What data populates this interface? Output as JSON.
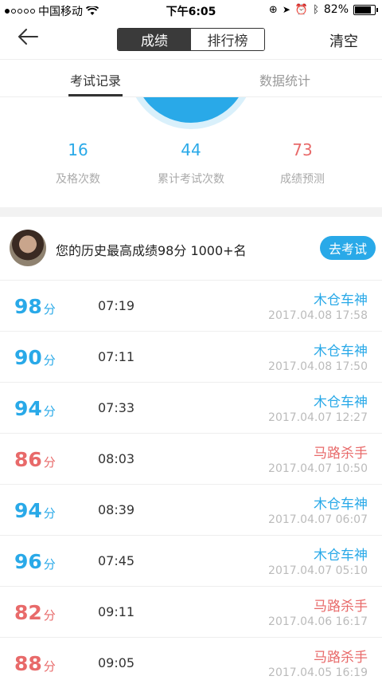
{
  "status_bar": {
    "carrier": "中国移动",
    "time": "下午6:05",
    "battery": "82%",
    "battery_level": 0.82
  },
  "nav": {
    "segments": [
      "成绩",
      "排行榜"
    ],
    "clear_label": "清空"
  },
  "tabs": [
    "考试记录",
    "数据统计"
  ],
  "stats": [
    {
      "value": "16",
      "label": "及格次数"
    },
    {
      "value": "44",
      "label": "累计考试次数"
    },
    {
      "value": "73",
      "label": "成绩预测"
    }
  ],
  "best": {
    "text": "您的历史最高成绩98分  1000+名",
    "button": "去考试"
  },
  "colors": {
    "accent_blue": "#29a9e8",
    "accent_red": "#e86a6a"
  },
  "records": [
    {
      "score": "98",
      "unit": "分",
      "duration": "07:19",
      "title": "木仓车神",
      "date": "2017.04.08 17:58",
      "tone": "blue"
    },
    {
      "score": "90",
      "unit": "分",
      "duration": "07:11",
      "title": "木仓车神",
      "date": "2017.04.08 17:50",
      "tone": "blue"
    },
    {
      "score": "94",
      "unit": "分",
      "duration": "07:33",
      "title": "木仓车神",
      "date": "2017.04.07 12:27",
      "tone": "blue"
    },
    {
      "score": "86",
      "unit": "分",
      "duration": "08:03",
      "title": "马路杀手",
      "date": "2017.04.07 10:50",
      "tone": "red"
    },
    {
      "score": "94",
      "unit": "分",
      "duration": "08:39",
      "title": "木仓车神",
      "date": "2017.04.07 06:07",
      "tone": "blue"
    },
    {
      "score": "96",
      "unit": "分",
      "duration": "07:45",
      "title": "木仓车神",
      "date": "2017.04.07 05:10",
      "tone": "blue"
    },
    {
      "score": "82",
      "unit": "分",
      "duration": "09:11",
      "title": "马路杀手",
      "date": "2017.04.06 16:17",
      "tone": "red"
    },
    {
      "score": "88",
      "unit": "分",
      "duration": "09:05",
      "title": "马路杀手",
      "date": "2017.04.05 16:19",
      "tone": "red"
    }
  ]
}
